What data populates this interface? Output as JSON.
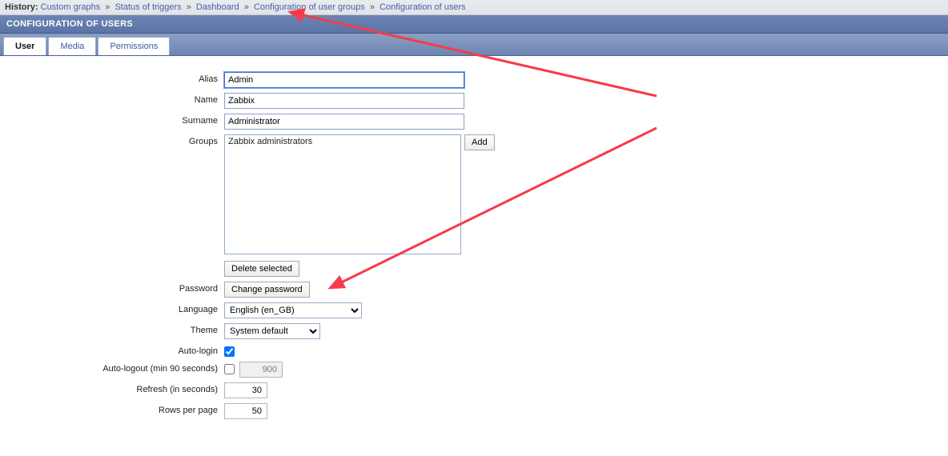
{
  "history": {
    "label": "History:",
    "items": [
      "Custom graphs",
      "Status of triggers",
      "Dashboard",
      "Configuration of user groups",
      "Configuration of users"
    ],
    "sep": "»"
  },
  "page_title": "CONFIGURATION OF USERS",
  "tabs": [
    {
      "label": "User",
      "active": true
    },
    {
      "label": "Media",
      "active": false
    },
    {
      "label": "Permissions",
      "active": false
    }
  ],
  "form": {
    "alias": {
      "label": "Alias",
      "value": "Admin"
    },
    "name": {
      "label": "Name",
      "value": "Zabbix"
    },
    "surname": {
      "label": "Surname",
      "value": "Administrator"
    },
    "groups": {
      "label": "Groups",
      "items": [
        "Zabbix administrators"
      ],
      "add": "Add",
      "delete": "Delete selected"
    },
    "password": {
      "label": "Password",
      "button": "Change password"
    },
    "language": {
      "label": "Language",
      "value": "English (en_GB)"
    },
    "theme": {
      "label": "Theme",
      "value": "System default"
    },
    "autologin": {
      "label": "Auto-login",
      "checked": true
    },
    "autologout": {
      "label": "Auto-logout (min 90 seconds)",
      "checked": false,
      "value": "900"
    },
    "refresh": {
      "label": "Refresh (in seconds)",
      "value": "30"
    },
    "rows": {
      "label": "Rows per page",
      "value": "50"
    }
  },
  "arrow_color": "#f63b4a"
}
